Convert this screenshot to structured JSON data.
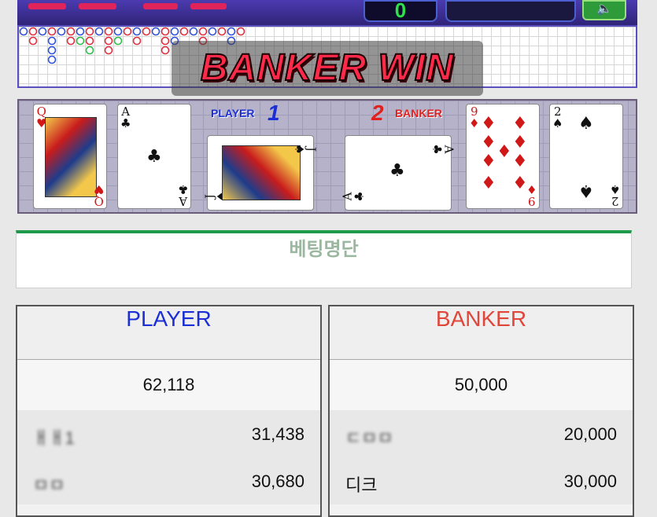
{
  "game": {
    "counter": "0",
    "top_button_label": "",
    "sound_icon": "speaker-icon",
    "result_banner": "BANKER WIN",
    "player_label": "PLAYER",
    "player_score": "1",
    "banker_label": "BANKER",
    "banker_score": "2",
    "player_cards": [
      {
        "rank": "Q",
        "suit": "♥",
        "color": "#d01818"
      },
      {
        "rank": "A",
        "suit": "♣",
        "color": "#111111"
      },
      {
        "rank": "J",
        "suit": "♠",
        "color": "#111111"
      }
    ],
    "banker_cards": [
      {
        "rank": "A",
        "suit": "♣",
        "color": "#111111"
      },
      {
        "rank": "9",
        "suit": "♦",
        "color": "#d01818"
      },
      {
        "rank": "2",
        "suit": "♠",
        "color": "#111111"
      }
    ]
  },
  "betting": {
    "title": "베팅명단",
    "player": {
      "header": "PLAYER",
      "header_color": "#1c2fd6",
      "total": "62,118",
      "rows": [
        {
          "name": "ㅐㅐ1",
          "amount": "31,438"
        },
        {
          "name": "ㅁㅁ",
          "amount": "30,680"
        }
      ]
    },
    "banker": {
      "header": "BANKER",
      "header_color": "#e0463a",
      "total": "50,000",
      "rows": [
        {
          "name": "ㄷㅁㅁ",
          "amount": "20,000"
        },
        {
          "name": "디크",
          "amount": "30,000"
        }
      ]
    }
  }
}
